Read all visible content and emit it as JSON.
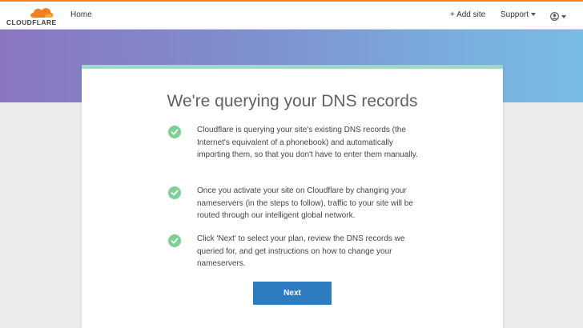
{
  "brand": {
    "name": "CLOUDFLARE",
    "accent": "#f38020"
  },
  "nav": {
    "home": "Home",
    "add_site": "+ Add site",
    "support": "Support",
    "user_icon": "user-circle-icon"
  },
  "card": {
    "title": "We're querying your DNS records",
    "items": [
      "Cloudflare is querying your site's existing DNS records (the Internet's equivalent of a phonebook) and automatically importing them, so that you don't have to enter them manually.",
      "Once you activate your site on Cloudflare by changing your nameservers (in the steps to follow), traffic to your site will be routed through our intelligent global network.",
      "Click 'Next' to select your plan, review the DNS records we queried for, and get instructions on how to change your nameservers."
    ],
    "next_label": "Next"
  },
  "colors": {
    "check": "#7fcf97",
    "button": "#2f7bbf",
    "card_accent": "#9fd8c8"
  }
}
